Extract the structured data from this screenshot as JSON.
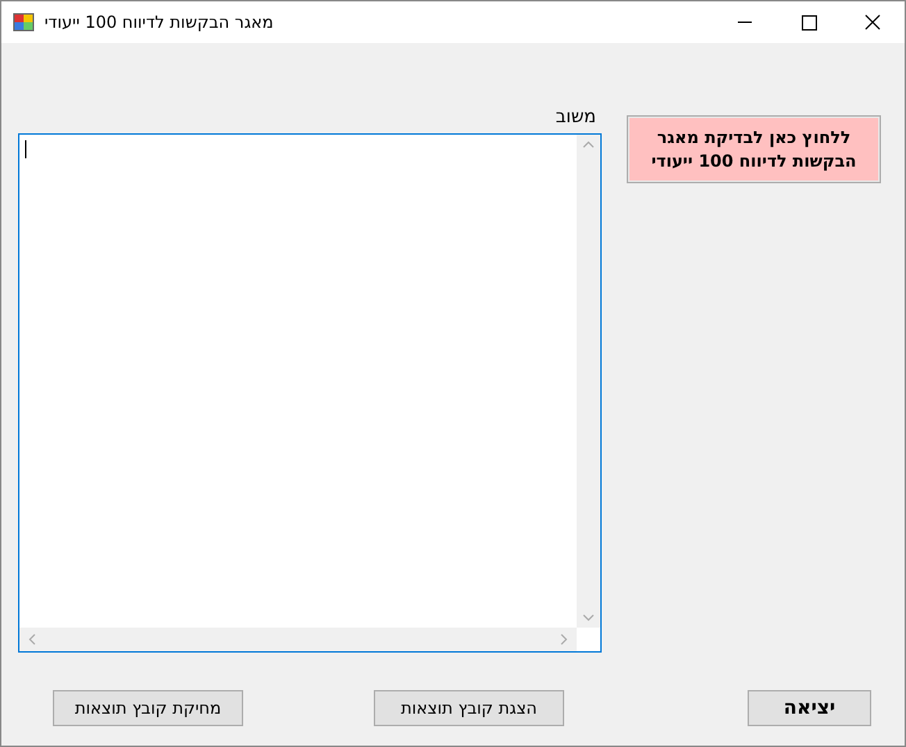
{
  "window": {
    "title": "מאגר הבקשות לדיווח 100 ייעודי"
  },
  "feedback": {
    "label": "משוב"
  },
  "check_button": {
    "label": "ללחוץ כאן לבדיקת מאגר הבקשות לדיווח 100 ייעודי"
  },
  "buttons": [
    {
      "label": "יציאה",
      "kind": "bold"
    },
    {
      "label": "הצגת קובץ תוצאות",
      "kind": "normal"
    },
    {
      "label": "מחיקת קובץ תוצאות",
      "kind": "normal"
    }
  ]
}
